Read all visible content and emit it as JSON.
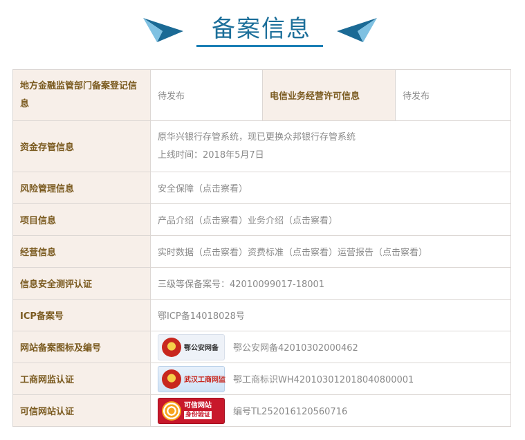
{
  "header": {
    "title": "备案信息"
  },
  "rows": [
    {
      "label": "地方金融监管部门备案登记信息",
      "value": "待发布",
      "label2": "电信业务经营许可信息",
      "value2": "待发布"
    },
    {
      "label": "资金存管信息",
      "value_line1": "原华兴银行存管系统，现已更换众邦银行存管系统",
      "value_line2": "上线时间：2018年5月7日"
    },
    {
      "label": "风险管理信息",
      "value": "安全保障（点击察看）"
    },
    {
      "label": "项目信息",
      "value": "产品介绍（点击察看）业务介绍（点击察看）"
    },
    {
      "label": "经营信息",
      "value": "实时数据（点击察看）资费标准（点击察看）运营报告（点击察看）"
    },
    {
      "label": "信息安全测评认证",
      "value": "三级等保备案号：42010099017-18001"
    },
    {
      "label": "ICP备案号",
      "value": "鄂ICP备14018028号"
    },
    {
      "label": "网站备案图标及编号",
      "badge": "鄂公安网备",
      "value": "鄂公安网备42010302000462"
    },
    {
      "label": "工商网监认证",
      "badge": "武汉工商网监",
      "value": "鄂工商标识WH420103012018040800001"
    },
    {
      "label": "可信网站认证",
      "badge_line1": "可信网站",
      "badge_line2": "身份验证",
      "value": "编号TL252016120560716"
    }
  ],
  "colors": {
    "accent": "#1c6f9a",
    "label_bg": "#f7efe9",
    "label_text": "#7a5a1f",
    "value_text": "#8a8a8a",
    "border": "#dcd7d4"
  }
}
